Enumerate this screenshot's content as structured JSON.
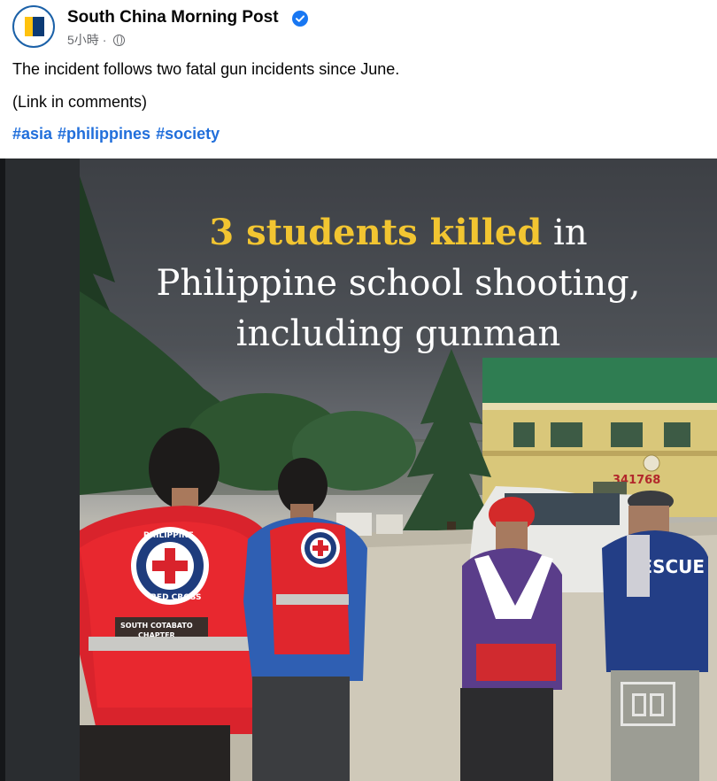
{
  "post": {
    "page_name": "South China Morning Post",
    "verified_icon": "verified-badge-icon",
    "timestamp": "5小時",
    "separator": "·",
    "audience_icon": "globe-icon",
    "lines": [
      "The incident follows two fatal gun incidents since June.",
      "(Link in comments)"
    ],
    "hashtags": [
      "#asia",
      "#philippines",
      "#society"
    ]
  },
  "image": {
    "headline_highlight": "3 students killed",
    "headline_rest_1": " in",
    "headline_2": "Philippine school shooting,",
    "headline_3": "including gunman",
    "vest_text_1": "PHILIPPINE",
    "vest_text_2": "RED CROSS",
    "vest_chapter_1": "SOUTH COTABATO",
    "vest_chapter_2": "CHAPTER",
    "building_number": "341768",
    "rescue_text": "RESCUE",
    "watermark_icon": "scmp-watermark-icon"
  },
  "colors": {
    "hashtag": "#216fdb",
    "headline_highlight": "#f2c531",
    "verified": "#1877f2",
    "brand_yellow": "#ffc20e",
    "brand_navy": "#0c3b75"
  }
}
